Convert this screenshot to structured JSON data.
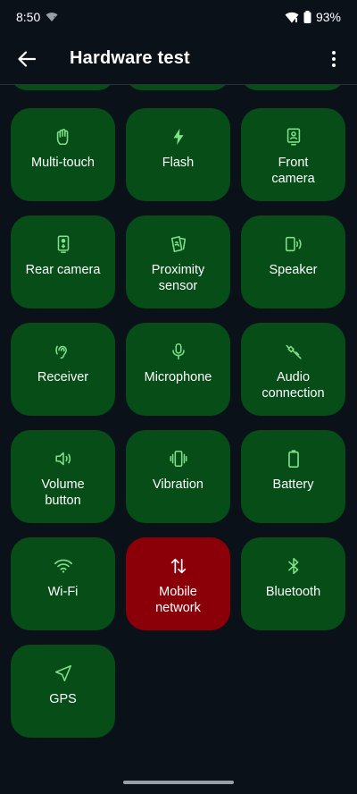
{
  "status": {
    "time": "8:50",
    "battery": "93%"
  },
  "app_bar": {
    "title": "Hardware test"
  },
  "tiles": [
    {
      "label": "Multi-touch",
      "icon": "touch-icon",
      "state": "ok"
    },
    {
      "label": "Flash",
      "icon": "flash-icon",
      "state": "ok"
    },
    {
      "label": "Front\ncamera",
      "icon": "front-camera-icon",
      "state": "ok"
    },
    {
      "label": "Rear camera",
      "icon": "rear-camera-icon",
      "state": "ok"
    },
    {
      "label": "Proximity\nsensor",
      "icon": "proximity-icon",
      "state": "ok"
    },
    {
      "label": "Speaker",
      "icon": "speaker-icon",
      "state": "ok"
    },
    {
      "label": "Receiver",
      "icon": "receiver-icon",
      "state": "ok"
    },
    {
      "label": "Microphone",
      "icon": "microphone-icon",
      "state": "ok"
    },
    {
      "label": "Audio\nconnection",
      "icon": "audio-connection-icon",
      "state": "ok"
    },
    {
      "label": "Volume\nbutton",
      "icon": "volume-icon",
      "state": "ok"
    },
    {
      "label": "Vibration",
      "icon": "vibration-icon",
      "state": "ok"
    },
    {
      "label": "Battery",
      "icon": "battery-icon",
      "state": "ok"
    },
    {
      "label": "Wi-Fi",
      "icon": "wifi-icon",
      "state": "ok"
    },
    {
      "label": "Mobile\nnetwork",
      "icon": "mobile-data-icon",
      "state": "error"
    },
    {
      "label": "Bluetooth",
      "icon": "bluetooth-icon",
      "state": "ok"
    },
    {
      "label": "GPS",
      "icon": "gps-icon",
      "state": "ok"
    }
  ],
  "colors": {
    "background": "#0b1119",
    "tile_ok": "#064d17",
    "tile_error": "#8b0008",
    "icon": "#7fe08a"
  }
}
